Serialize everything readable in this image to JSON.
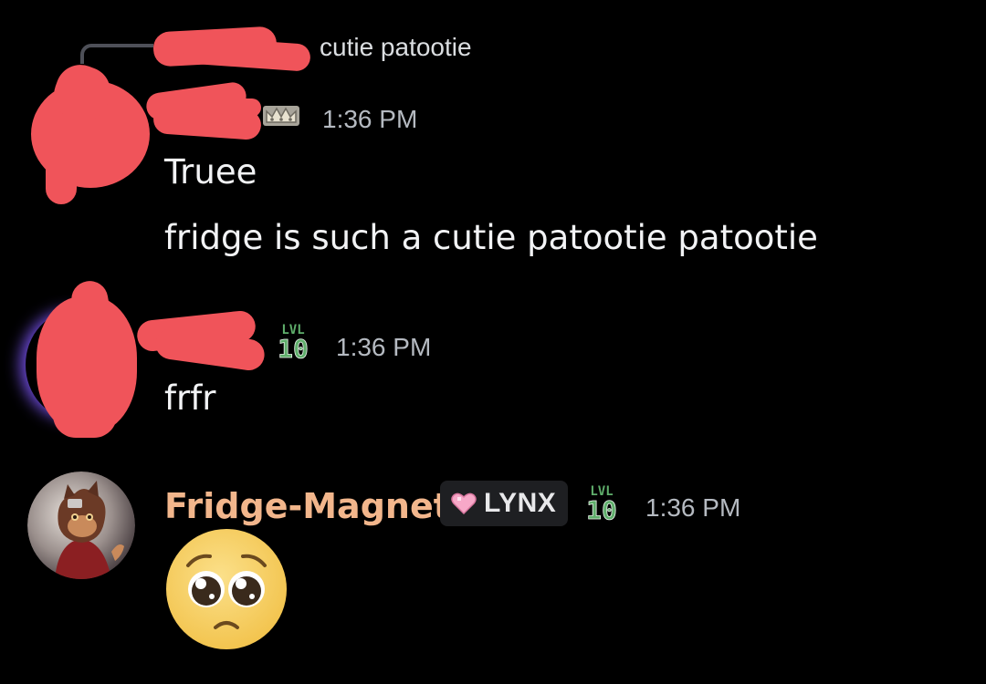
{
  "messages": [
    {
      "reply_preview": {
        "text": "cutie patootie"
      },
      "badge": "crown-icon",
      "timestamp": "1:36 PM",
      "lines": [
        "Truee",
        "fridge is such a cutie patootie patootie"
      ]
    },
    {
      "badge": "lvl-10",
      "timestamp": "1:36 PM",
      "lines": [
        "frfr"
      ]
    },
    {
      "author": "Fridge-Magnet",
      "tag": {
        "label": "LYNX",
        "icon": "heart-icon"
      },
      "badge": "lvl-10",
      "timestamp": "1:36 PM",
      "content_emoji": "pleading-face-emoji"
    }
  ],
  "badges": {
    "lvl": {
      "top": "LVL",
      "number": "10"
    }
  },
  "colors": {
    "background": "#000000",
    "redaction": "#f0545a",
    "username": "#f2b68c",
    "timestamp": "#b5bac1",
    "level_badge": "#5fae6b",
    "tag_bg": "#1e1f22",
    "heart": "#f7a8c8"
  }
}
